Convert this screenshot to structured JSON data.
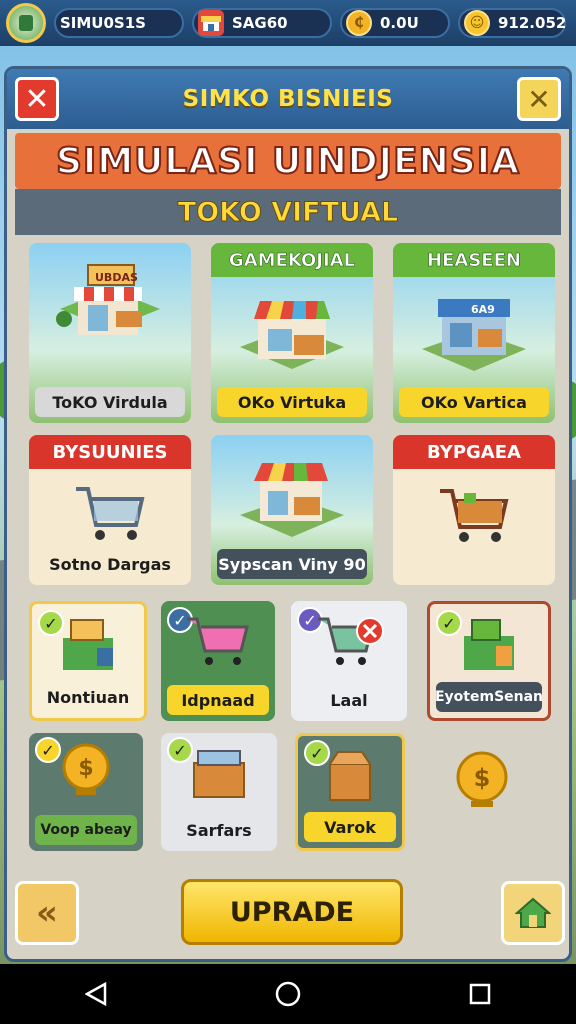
{
  "topbar": {
    "player_name": "SIMU0S1S",
    "pill2_label": "SAG60",
    "pill3_label": "0.0U",
    "pill4_label": "912.052"
  },
  "panel": {
    "title": "SIMKO BISNIEIS",
    "banner": "SIMULASI UINDJENSIA",
    "subbanner": "TOKO VIFTUAL"
  },
  "row1": [
    {
      "head": "",
      "label": "ToKO Virdula",
      "sign": "UBDAS",
      "accent": "#f0c94c"
    },
    {
      "head": "GAMEKOJIAL",
      "label": "OKo Virtuka",
      "sign": "",
      "accent": "#7bc043"
    },
    {
      "head": "HEASEEN",
      "label": "OKo Vartica",
      "sign": "6A9",
      "accent": "#5aa73f"
    }
  ],
  "row2": [
    {
      "head": "BYSUUNIES",
      "label": "Sotno Dargas"
    },
    {
      "head": "",
      "label": "Sypscan Viny 90"
    },
    {
      "head": "BYPGAEA",
      "label": ""
    }
  ],
  "row3": [
    {
      "label": "Nontiuan",
      "checked": true
    },
    {
      "label": "Idpnaad",
      "checked": true
    },
    {
      "label": "Laal",
      "checked": true
    },
    {
      "label": "EyotemSenan",
      "checked": true
    }
  ],
  "row4": [
    {
      "label": "Voop abeay",
      "checked": true
    },
    {
      "label": "Sarfars",
      "checked": true
    },
    {
      "label": "Varok",
      "checked": true
    }
  ],
  "bottom": {
    "upgrade": "UPRADE",
    "back_glyph": "«"
  },
  "colors": {
    "accent_orange": "#e8703a",
    "accent_yellow": "#ffd83a",
    "head_red": "#d9352b",
    "head_green": "#67b73c"
  }
}
